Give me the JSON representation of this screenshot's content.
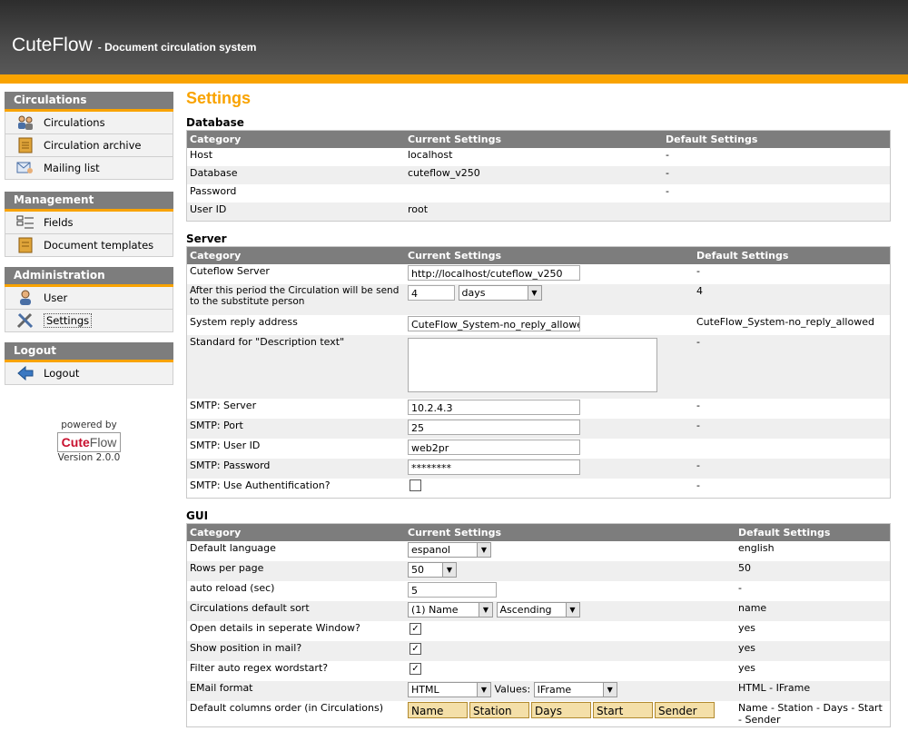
{
  "header": {
    "app_name": "CuteFlow",
    "tagline": "- Document circulation system"
  },
  "sidebar": {
    "sections": [
      {
        "title": "Circulations",
        "items": [
          {
            "label": "Circulations",
            "icon": "users-icon"
          },
          {
            "label": "Circulation archive",
            "icon": "archive-icon"
          },
          {
            "label": "Mailing list",
            "icon": "mailing-list-icon"
          }
        ]
      },
      {
        "title": "Management",
        "items": [
          {
            "label": "Fields",
            "icon": "fields-icon"
          },
          {
            "label": "Document templates",
            "icon": "document-icon"
          }
        ]
      },
      {
        "title": "Administration",
        "items": [
          {
            "label": "User",
            "icon": "user-icon"
          },
          {
            "label": "Settings",
            "icon": "settings-icon"
          }
        ]
      },
      {
        "title": "Logout",
        "items": [
          {
            "label": "Logout",
            "icon": "logout-icon"
          }
        ]
      }
    ],
    "powered_by": "powered by",
    "logo": {
      "part1": "Cute",
      "part2": "Flow"
    },
    "version": "Version 2.0.0"
  },
  "main": {
    "title": "Settings",
    "database": {
      "heading": "Database",
      "headers": [
        "Category",
        "Current Settings",
        "Default Settings"
      ],
      "rows": [
        {
          "cat": "Host",
          "cur": "localhost",
          "def": "-"
        },
        {
          "cat": "Database",
          "cur": "cuteflow_v250",
          "def": "-"
        },
        {
          "cat": "Password",
          "cur": "",
          "def": "-"
        },
        {
          "cat": "User ID",
          "cur": "root",
          "def": ""
        }
      ]
    },
    "server": {
      "heading": "Server",
      "headers": [
        "Category",
        "Current Settings",
        "Default Settings"
      ],
      "cuteflow_server": {
        "cat": "Cuteflow Server",
        "val": "http://localhost/cuteflow_v250",
        "def": "-"
      },
      "substitute": {
        "cat": "After this period the Circulation will be send to the substitute person",
        "val": "4",
        "unit": "days",
        "def": "4"
      },
      "reply": {
        "cat": "System reply address",
        "val": "CuteFlow_System-no_reply_allowed",
        "def": "CuteFlow_System-no_reply_allowed"
      },
      "desc": {
        "cat": "Standard for \"Description text\"",
        "val": "",
        "def": "-"
      },
      "smtp_server": {
        "cat": "SMTP: Server",
        "val": "10.2.4.3",
        "def": "-"
      },
      "smtp_port": {
        "cat": "SMTP: Port",
        "val": "25",
        "def": "-"
      },
      "smtp_user": {
        "cat": "SMTP: User ID",
        "val": "web2pr",
        "def": ""
      },
      "smtp_pass": {
        "cat": "SMTP: Password",
        "val": "********",
        "def": "-"
      },
      "smtp_auth": {
        "cat": "SMTP: Use Authentification?",
        "checked": "",
        "def": "-"
      }
    },
    "gui": {
      "heading": "GUI",
      "headers": [
        "Category",
        "Current Settings",
        "Default Settings"
      ],
      "language": {
        "cat": "Default language",
        "val": "espanol",
        "def": "english"
      },
      "rows_per_page": {
        "cat": "Rows per page",
        "val": "50",
        "def": "50"
      },
      "auto_reload": {
        "cat": "auto reload (sec)",
        "val": "5",
        "def": "-"
      },
      "sort": {
        "cat": "Circulations default sort",
        "val": "(1) Name",
        "order": "Ascending",
        "def": "name"
      },
      "open_details": {
        "cat": "Open details in seperate Window?",
        "checked": "✓",
        "def": "yes"
      },
      "show_position": {
        "cat": "Show position in mail?",
        "checked": "✓",
        "def": "yes"
      },
      "filter_regex": {
        "cat": "Filter auto regex wordstart?",
        "checked": "✓",
        "def": "yes"
      },
      "email_format": {
        "cat": "EMail format",
        "val": "HTML",
        "values_label": "Values:",
        "values_val": "IFrame",
        "def": "HTML - IFrame"
      },
      "columns_order": {
        "cat": "Default columns order (in Circulations)",
        "cols": [
          "Name",
          "Station",
          "Days",
          "Start",
          "Sender"
        ],
        "def": "Name - Station - Days - Start - Sender"
      }
    }
  }
}
